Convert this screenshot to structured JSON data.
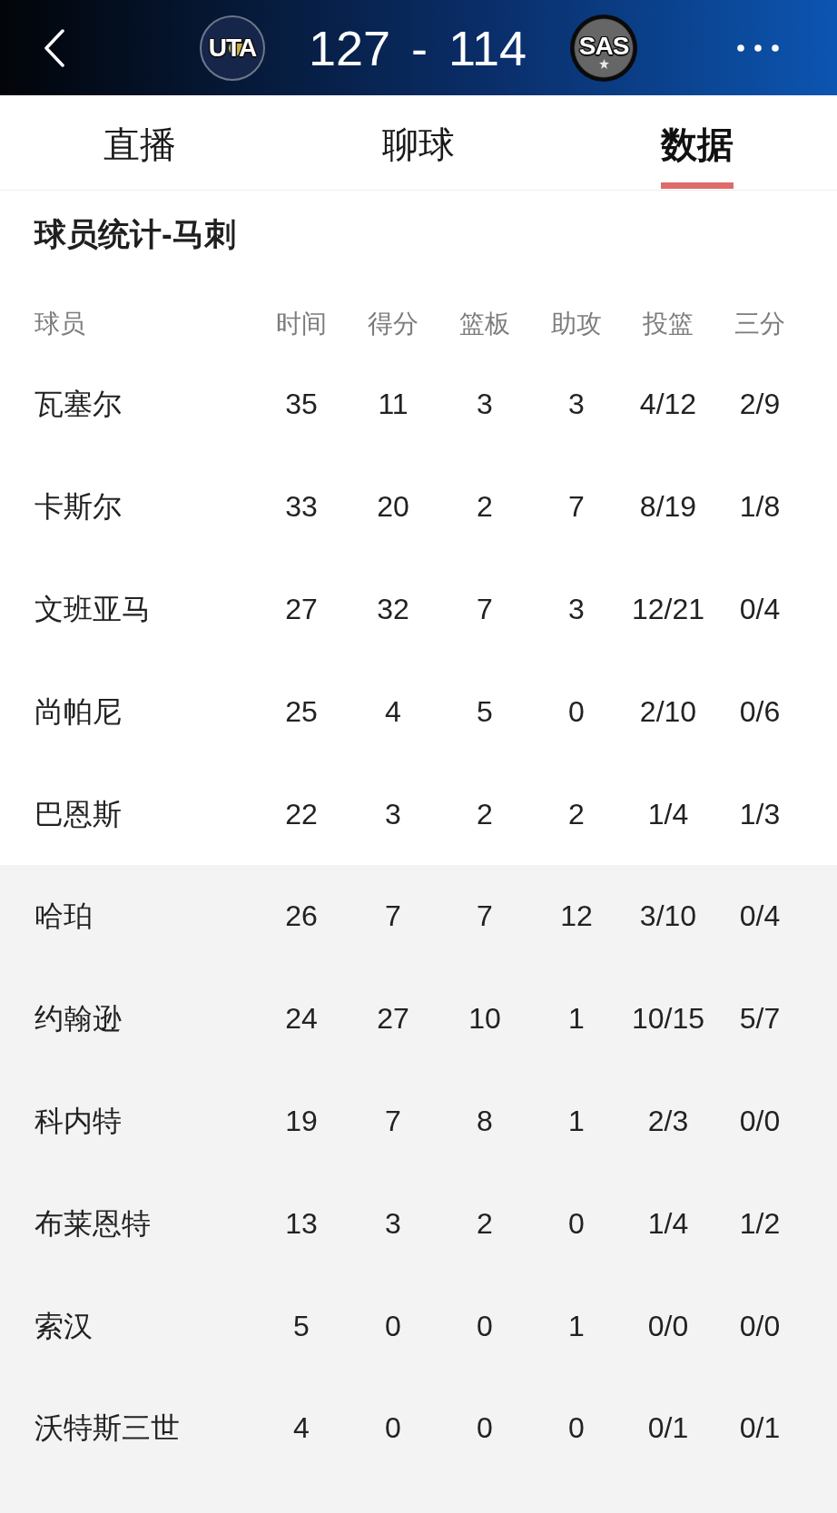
{
  "header": {
    "home_team": {
      "abbr": "UTA"
    },
    "score": "127 - 114",
    "away_team": {
      "abbr": "SAS"
    }
  },
  "tabs": [
    {
      "label": "直播",
      "selected": false
    },
    {
      "label": "聊球",
      "selected": false
    },
    {
      "label": "数据",
      "selected": true
    }
  ],
  "section": {
    "title": "球员统计-马刺"
  },
  "table": {
    "columns": [
      "球员",
      "时间",
      "得分",
      "篮板",
      "助攻",
      "投篮",
      "三分"
    ],
    "rows": [
      {
        "player": "瓦塞尔",
        "stats": [
          "35",
          "11",
          "3",
          "3",
          "4/12",
          "2/9"
        ],
        "bench": false
      },
      {
        "player": "卡斯尔",
        "stats": [
          "33",
          "20",
          "2",
          "7",
          "8/19",
          "1/8"
        ],
        "bench": false
      },
      {
        "player": "文班亚马",
        "stats": [
          "27",
          "32",
          "7",
          "3",
          "12/21",
          "0/4"
        ],
        "bench": false
      },
      {
        "player": "尚帕尼",
        "stats": [
          "25",
          "4",
          "5",
          "0",
          "2/10",
          "0/6"
        ],
        "bench": false
      },
      {
        "player": "巴恩斯",
        "stats": [
          "22",
          "3",
          "2",
          "2",
          "1/4",
          "1/3"
        ],
        "bench": false
      },
      {
        "player": "哈珀",
        "stats": [
          "26",
          "7",
          "7",
          "12",
          "3/10",
          "0/4"
        ],
        "bench": true
      },
      {
        "player": "约翰逊",
        "stats": [
          "24",
          "27",
          "10",
          "1",
          "10/15",
          "5/7"
        ],
        "bench": true
      },
      {
        "player": "科内特",
        "stats": [
          "19",
          "7",
          "8",
          "1",
          "2/3",
          "0/0"
        ],
        "bench": true
      },
      {
        "player": "布莱恩特",
        "stats": [
          "13",
          "3",
          "2",
          "0",
          "1/4",
          "1/2"
        ],
        "bench": true
      },
      {
        "player": "索汉",
        "stats": [
          "5",
          "0",
          "0",
          "1",
          "0/0",
          "0/0"
        ],
        "bench": true
      },
      {
        "player": "沃特斯三世",
        "stats": [
          "4",
          "0",
          "0",
          "0",
          "0/1",
          "0/1"
        ],
        "bench": true
      }
    ]
  }
}
